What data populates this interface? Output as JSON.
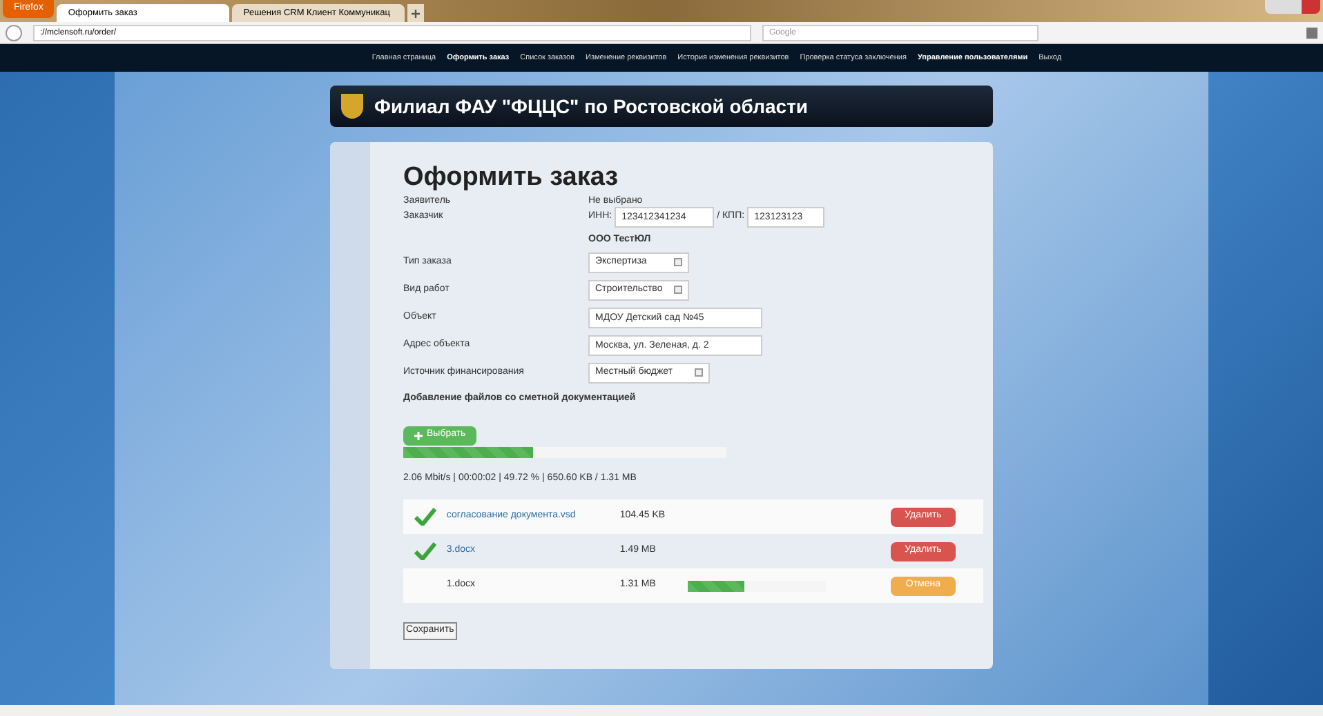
{
  "browser": {
    "menu_button": "Firefox",
    "tabs": [
      {
        "label": "Оформить заказ",
        "selected": true
      },
      {
        "label": "Решения CRM Клиент Коммуникац",
        "selected": false
      }
    ],
    "url": "://mclensoft.ru/order/",
    "search_placeholder": "Google"
  },
  "nav": [
    {
      "label": "Главная страница",
      "bold": false
    },
    {
      "label": "Оформить заказ",
      "bold": true
    },
    {
      "label": "Список заказов",
      "bold": false
    },
    {
      "label": "Изменение реквизитов",
      "bold": false
    },
    {
      "label": "История изменения реквизитов",
      "bold": false
    },
    {
      "label": "Проверка статуса заключения",
      "bold": false
    },
    {
      "label": "Управление пользователями",
      "bold": true
    },
    {
      "label": "Выход",
      "bold": false
    }
  ],
  "header": {
    "title": "Филиал ФАУ \"ФЦЦС\" по Ростовской области"
  },
  "form": {
    "title": "Оформить заказ",
    "applicant": {
      "label": "Заявитель",
      "value": "Не выбрано"
    },
    "customer": {
      "label": "Заказчик",
      "inn_label": "ИНН:",
      "inn": "123412341234",
      "kpp_label": "/ КПП:",
      "kpp": "123123123",
      "org": "ООО ТестЮЛ"
    },
    "fields": [
      {
        "kind": "select",
        "label": "Тип заказа",
        "value": "Экспертиза"
      },
      {
        "kind": "select",
        "label": "Вид работ",
        "value": "Строительство"
      },
      {
        "kind": "input",
        "label": "Объект",
        "value": "МДОУ Детский сад №45"
      },
      {
        "kind": "input",
        "label": "Адрес объекта",
        "value": "Москва, ул. Зеленая, д. 2"
      },
      {
        "kind": "select",
        "label": "Источник финансирования",
        "value": "Местный бюджет"
      }
    ],
    "upload": {
      "title": "Добавление файлов со сметной документацией",
      "choose_button": "Выбрать",
      "level": 0.4,
      "stats": "2.06 Mbit/s | 00:00:02 | 49.72 % | 650.60 KB / 1.31 MB",
      "files": [
        {
          "kind": "done",
          "name": "согласование документа.vsd",
          "size": "104.45 KB",
          "action": "Удалить"
        },
        {
          "kind": "done",
          "name": "3.docx",
          "size": "1.49 MB",
          "action": "Удалить"
        },
        {
          "kind": "uploading",
          "name": "1.docx",
          "size": "1.31 MB",
          "level": 0.41,
          "action": "Отмена"
        }
      ]
    },
    "save_button": "Сохранить"
  }
}
